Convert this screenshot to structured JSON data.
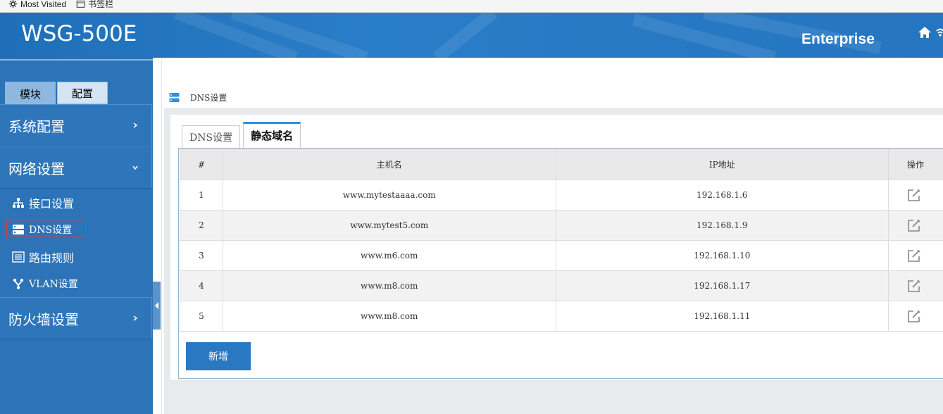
{
  "bookmarks": {
    "most_visited": "Most Visited",
    "bookmarks_toolbar": "书签栏",
    "most_visited_icon": "gear-icon",
    "toolbar_icon": "folder-icon"
  },
  "header": {
    "logo": "WSG-500E",
    "edition": "Enterprise",
    "home_icon": "home-icon",
    "wifi_icon": "wifi-icon"
  },
  "sidebar": {
    "tabs": [
      {
        "label": "模块",
        "active": false
      },
      {
        "label": "配置",
        "active": true
      }
    ],
    "groups": {
      "system": "系统配置",
      "network": "网络设置",
      "firewall": "防火墙设置"
    },
    "network_items": [
      {
        "label": "接口设置",
        "icon": "sitemap-icon"
      },
      {
        "label": "DNS设置",
        "icon": "server-icon",
        "selected": true
      },
      {
        "label": "路由规则",
        "icon": "list-icon"
      },
      {
        "label": "VLAN设置",
        "icon": "fork-icon"
      }
    ]
  },
  "breadcrumb": {
    "icon": "server-icon",
    "label": "DNS设置"
  },
  "tabs": {
    "dns": "DNS设置",
    "static": "静态域名"
  },
  "table": {
    "headers": [
      "#",
      "主机名",
      "IP地址",
      "操作"
    ],
    "rows": [
      {
        "idx": "1",
        "host": "www.mytestaaaa.com",
        "ip": "192.168.1.6"
      },
      {
        "idx": "2",
        "host": "www.mytest5.com",
        "ip": "192.168.1.9"
      },
      {
        "idx": "3",
        "host": "www.m6.com",
        "ip": "192.168.1.10"
      },
      {
        "idx": "4",
        "host": "www.m8.com",
        "ip": "192.168.1.17"
      },
      {
        "idx": "5",
        "host": "www.m8.com",
        "ip": "192.168.1.11"
      }
    ]
  },
  "actions": {
    "add": "新增"
  },
  "colors": {
    "header_blue": "#1f6fb8",
    "sidebar_blue": "#2c73b7",
    "button_blue": "#2b78c2",
    "selection_red": "#e23b3b"
  }
}
